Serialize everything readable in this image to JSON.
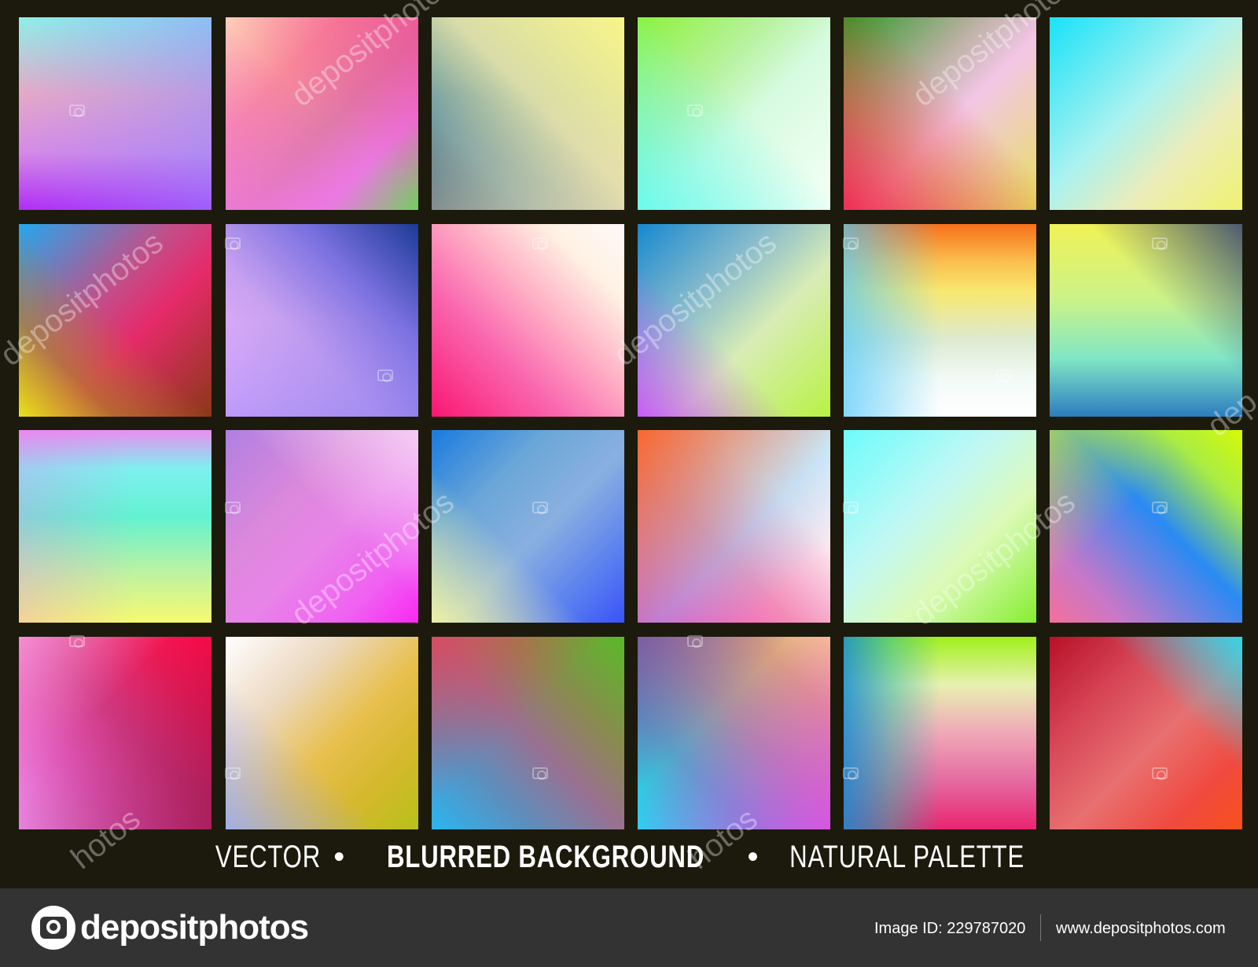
{
  "caption": {
    "part1": "VECTOR",
    "sep1": "•",
    "part2": "BLURRED BACKGROUND",
    "sep2": "•",
    "part3": "NATURAL PALETTE"
  },
  "watermark": {
    "text": "depositphotos",
    "fragment_text": "hotos",
    "fragment_text2": "dep"
  },
  "footer": {
    "logo_text": "depositphotos",
    "image_id": "Image ID: 229787020",
    "site_url": "www.depositphotos.com"
  },
  "swatches": [
    {
      "bg": "linear-gradient(180deg,#8ef0e8 0%,#e6a8c8 40%,#d58ae6 70%,#b22cf6 100%)",
      "overlay": "linear-gradient(90deg,rgba(0,0,0,0) 0%,rgba(140,140,255,0.5) 100%)"
    },
    {
      "bg": "linear-gradient(135deg,#ffd0b8 0%,#f8889a 30%,#e07aa8 55%,#ea78e0 75%,#6fd15a 100%)",
      "overlay": "linear-gradient(45deg,rgba(240,120,240,0.6) 0%,rgba(0,0,0,0) 50%,rgba(240,60,140,0.5) 100%)"
    },
    {
      "bg": "linear-gradient(45deg,#0a3c6a 0%,#6a98a0 25%,#d8dca8 55%,#f8f58a 100%)",
      "overlay": "linear-gradient(0deg,rgba(250,225,180,0.5) 0%,rgba(0,0,0,0) 60%)"
    },
    {
      "bg": "linear-gradient(135deg,#8df23a 0%,#b8f2a0 35%,#d6fbe0 55%,#f6fff6 100%)",
      "overlay": "linear-gradient(45deg,rgba(90,250,240,0.85) 0%,rgba(0,0,0,0) 55%)"
    },
    {
      "bg": "linear-gradient(135deg,#2e9a28 0%,#b8b0a0 35%,#f3c6e6 55%,#e6e060 100%)",
      "overlay": "linear-gradient(45deg,rgba(240,30,70,0.9) 0%,rgba(230,60,40,0.5) 30%,rgba(0,0,0,0) 60%)"
    },
    {
      "bg": "linear-gradient(135deg,#18e2f8 0%,#aaf2f0 45%,#ececb8 70%,#f0f270 100%)",
      "overlay": "none"
    },
    {
      "bg": "linear-gradient(135deg,#22a8f0 0%,#c0508a 40%,#e62a6a 60%,#8a3818 100%)",
      "overlay": "linear-gradient(45deg,rgba(235,235,20,0.95) 0%,rgba(170,140,30,0.6) 25%,rgba(0,0,0,0) 50%)"
    },
    {
      "bg": "linear-gradient(45deg,#f2b8ff 0%,#c6a0f0 40%,#7a70e0 70%,#1c3a96 100%)",
      "overlay": "linear-gradient(0deg,rgba(110,110,240,0.4) 0%,rgba(0,0,0,0) 50%)"
    },
    {
      "bg": "linear-gradient(45deg,#fa1672 0%,#fa6ab0 35%,#ffb8c8 60%,#fff2e4 80%,#fff8f8 100%)",
      "overlay": "none"
    },
    {
      "bg": "linear-gradient(135deg,#1688d0 0%,#8abccc 35%,#d8ecb6 60%,#b8f244 100%)",
      "overlay": "linear-gradient(45deg,rgba(200,80,250,0.9) 0%,rgba(0,0,0,0) 40%)"
    },
    {
      "bg": "linear-gradient(180deg,#f8701a 0%,#fac050 20%,#f8e870 35%,#dcead0 60%,#f2faf6 80%,#ffffff 100%)",
      "overlay": "linear-gradient(90deg,rgba(80,200,250,0.7) 0%,rgba(0,0,0,0) 50%)"
    },
    {
      "bg": "linear-gradient(180deg,#f0f256 0%,#caf28a 40%,#80e6c6 70%,#2c7cbe 100%)",
      "overlay": "linear-gradient(45deg,rgba(0,0,0,0) 60%,rgba(20,40,120,0.75) 100%)"
    },
    {
      "bg": "linear-gradient(0deg,#f6fa70 0%,#c0f2a0 25%,#62f2d0 55%,#7ef0f0 80%,#e88ef0 100%)",
      "overlay": "linear-gradient(90deg,rgba(240,120,240,0.3) 0%,rgba(0,0,0,0) 60%)"
    },
    {
      "bg": "linear-gradient(135deg,#b080e0 0%,#dc88dc 35%,#e884e8 55%,#f060f2 80%,#f828f2 100%)",
      "overlay": "linear-gradient(45deg,rgba(0,0,0,0) 55%,rgba(255,255,255,0.6) 100%)"
    },
    {
      "bg": "linear-gradient(135deg,#1a7ae0 0%,#6aa6d8 30%,#8ab0e0 55%,#5a80f0 80%,#3a52f8 100%)",
      "overlay": "linear-gradient(45deg,rgba(245,245,160,0.95) 0%,rgba(0,0,0,0) 40%)"
    },
    {
      "bg": "linear-gradient(45deg,#f440c0 0%,#f48ab8 40%,#fbe8f0 70%,#ffffff 100%)",
      "overlay": "linear-gradient(135deg,rgba(250,100,40,0.95) 0%,rgba(120,200,240,0.4) 55%,rgba(0,0,0,0) 80%)"
    },
    {
      "bg": "linear-gradient(135deg,#6cfcfc 0%,#c2f8f4 40%,#dcfab8 65%,#86ee30 100%)",
      "overlay": "none"
    },
    {
      "bg": "linear-gradient(45deg,#f4709a 0%,#c878c8 20%,#2a8af4 55%,#a8ec44 80%,#d6fa08 100%)",
      "overlay": "linear-gradient(135deg,rgba(220,250,20,0.6) 0%,rgba(0,0,0,0) 40%)"
    },
    {
      "bg": "linear-gradient(45deg,#f090f0 0%,#e058b8 30%,#d03880 55%,#ea1a56 80%,#ff0a48 100%)",
      "overlay": "linear-gradient(135deg,rgba(255,160,230,0.8) 0%,rgba(0,0,0,0) 40%,rgba(140,10,60,0.6) 100%)"
    },
    {
      "bg": "linear-gradient(135deg,#ffffff 0%,#ecd8c0 30%,#e8c050 55%,#d8b830 75%,#b8c018 100%)",
      "overlay": "linear-gradient(45deg,rgba(150,170,250,0.85) 0%,rgba(0,0,0,0) 40%)"
    },
    {
      "bg": "linear-gradient(45deg,#2ab6f0 0%,#5a90c0 25%,#9a7090 50%,#8a8a50 70%,#5aba28 100%)",
      "overlay": "linear-gradient(135deg,rgba(240,60,80,0.7) 0%,rgba(0,0,0,0) 45%)"
    },
    {
      "bg": "linear-gradient(45deg,#1ae0f0 0%,#5aa0c8 30%,#a890a0 55%,#d8a080 80%,#f8c890 100%)",
      "overlay": "linear-gradient(135deg,rgba(110,70,160,0.7) 0%,rgba(0,0,0,0) 40%,rgba(240,60,250,0.7) 100%)"
    },
    {
      "bg": "linear-gradient(180deg,#a0f01a 0%,#e8f0b0 25%,#f0a8b8 50%,#e46aa0 75%,#ea2470 100%)",
      "overlay": "linear-gradient(90deg,rgba(20,140,210,0.85) 0%,rgba(40,180,170,0.5) 25%,rgba(0,0,0,0) 50%)"
    },
    {
      "bg": "linear-gradient(135deg,#b81028 0%,#d84858 30%,#e87070 55%,#f04a40 80%,#f8501a 100%)",
      "overlay": "linear-gradient(225deg,rgba(40,220,240,0.95) 0%,rgba(0,0,0,0) 35%)"
    }
  ]
}
